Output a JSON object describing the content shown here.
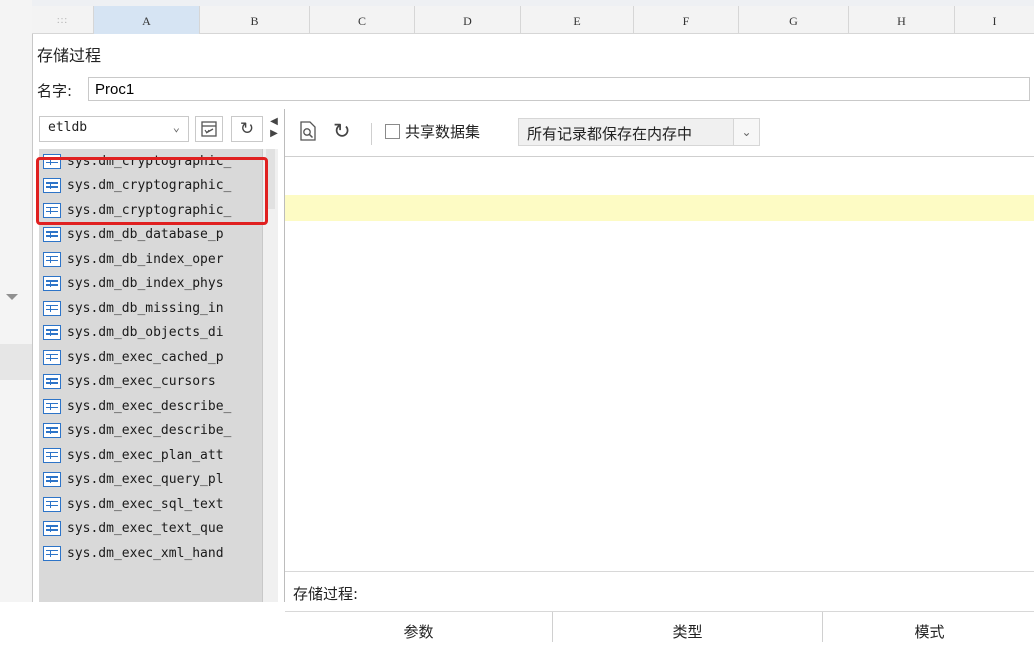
{
  "spreadsheet": {
    "corner": ":::",
    "columns": [
      "A",
      "B",
      "C",
      "D",
      "E",
      "F",
      "G",
      "H",
      "I"
    ]
  },
  "dialog": {
    "title": "存储过程",
    "name_label": "名字:",
    "name_value": "Proc1"
  },
  "left": {
    "database": "etldb",
    "items": [
      "sys.dm_cryptographic_",
      "sys.dm_cryptographic_",
      "sys.dm_cryptographic_",
      "sys.dm_db_database_p",
      "sys.dm_db_index_oper",
      "sys.dm_db_index_phys",
      "sys.dm_db_missing_in",
      "sys.dm_db_objects_di",
      "sys.dm_exec_cached_p",
      "sys.dm_exec_cursors",
      "sys.dm_exec_describe_",
      "sys.dm_exec_describe_",
      "sys.dm_exec_plan_att",
      "sys.dm_exec_query_pl",
      "sys.dm_exec_sql_text",
      "sys.dm_exec_text_que",
      "sys.dm_exec_xml_hand"
    ],
    "icons": {
      "dropdown": "chevron-down-icon",
      "edit": "edit-sql-icon",
      "refresh": "refresh-icon",
      "item": "table-icon"
    }
  },
  "right": {
    "toolbar": {
      "preview_icon": "preview-icon",
      "refresh_icon": "refresh-icon",
      "share_label": "共享数据集",
      "share_checked": false,
      "mode_value": "所有记录都保存在内存中"
    },
    "stored_proc_label": "存储过程:",
    "param_columns": [
      "参数",
      "类型",
      "模式"
    ]
  },
  "colors": {
    "highlight": "#e02020",
    "row_yellow": "#fdfbc4",
    "accent": "#2d74c8"
  }
}
